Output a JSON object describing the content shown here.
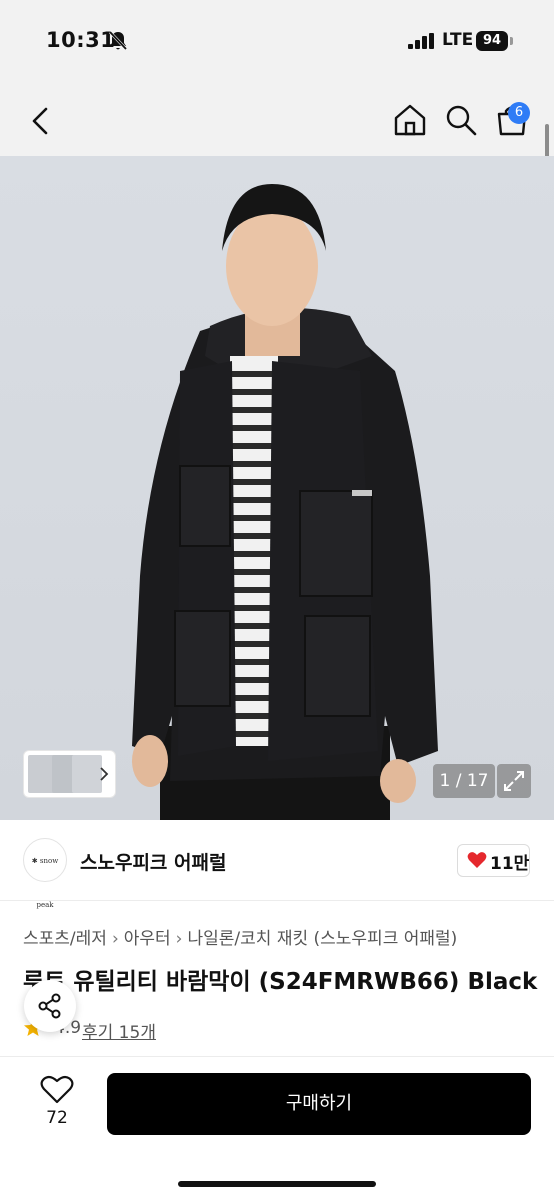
{
  "status_bar": {
    "time": "10:31",
    "network": "LTE",
    "battery": "94"
  },
  "nav": {
    "cart_count": "6"
  },
  "product_image": {
    "page_counter": "1 / 17"
  },
  "shop": {
    "logo_text": "✱ snow peak",
    "name": "스노우피크 어패럴",
    "likes": "11만"
  },
  "breadcrumb": {
    "items": [
      "스포츠/레저",
      "아우터",
      "나일론/코치 재킷 (스노우피크 어패럴)"
    ]
  },
  "product": {
    "title": "루트 유틸리티 바람막이 (S24FMRWB66) Black",
    "rating": "4.9",
    "reviews": "후기 15개"
  },
  "bottom_bar": {
    "wish_count": "72",
    "buy_label": "구매하기"
  },
  "colors": {
    "badge": "#2f7cf6",
    "like_heart": "#e5282d",
    "star": "#f5b301",
    "buy_button": "#000000"
  }
}
